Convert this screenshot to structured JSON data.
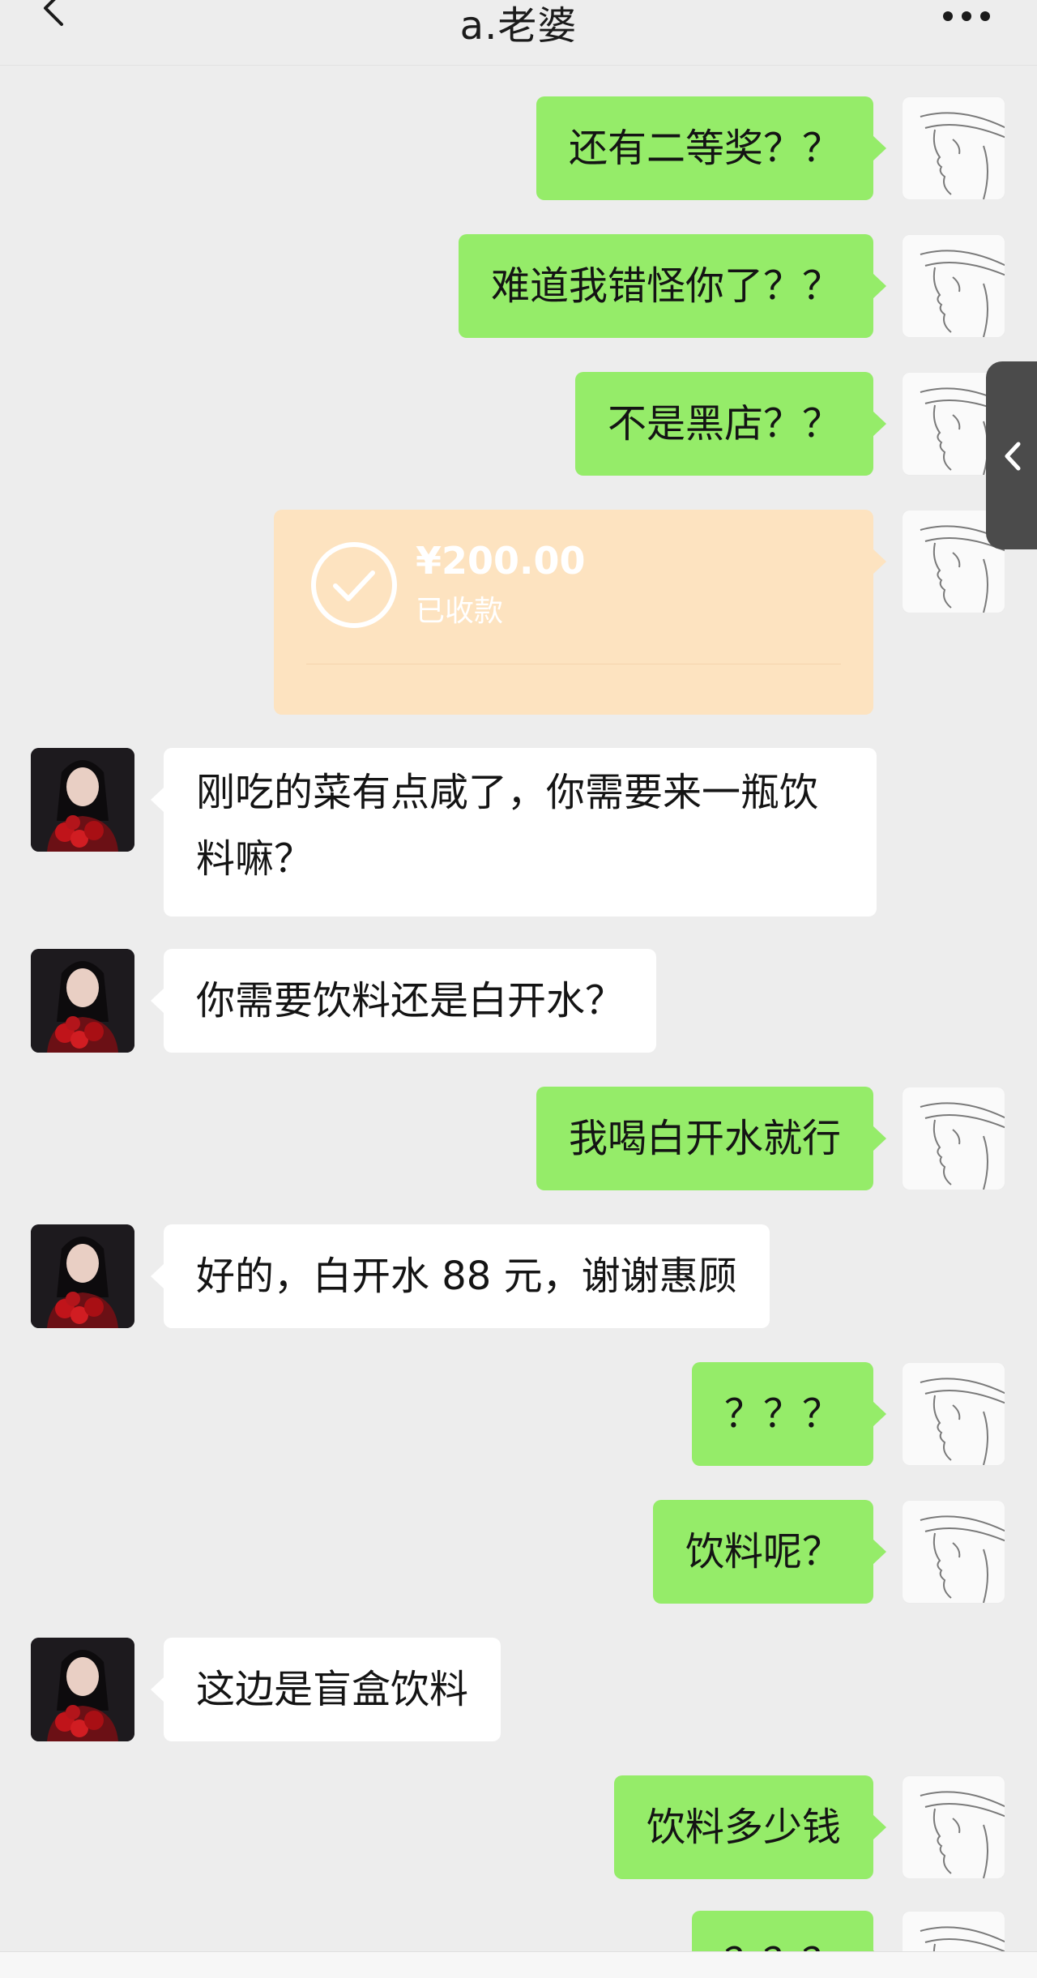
{
  "header": {
    "title": "a.老婆",
    "back_icon": "chevron-left-icon",
    "more_icon": "more-dots-icon"
  },
  "messages": [
    {
      "sender": "me",
      "text": "还有二等奖？？"
    },
    {
      "sender": "me",
      "text": "难道我错怪你了？？"
    },
    {
      "sender": "me",
      "text": "不是黑店？？"
    },
    {
      "sender": "me",
      "type": "transfer",
      "amount": "¥200.00",
      "status": "已收款"
    },
    {
      "sender": "her",
      "text": "刚吃的菜有点咸了，你需要来一瓶饮料嘛？"
    },
    {
      "sender": "her",
      "text": "你需要饮料还是白开水？"
    },
    {
      "sender": "me",
      "text": "我喝白开水就行"
    },
    {
      "sender": "her",
      "text": "好的，白开水 88 元，谢谢惠顾"
    },
    {
      "sender": "me",
      "text": "？？？"
    },
    {
      "sender": "me",
      "text": "饮料呢？"
    },
    {
      "sender": "her",
      "text": "这边是盲盒饮料"
    },
    {
      "sender": "me",
      "text": "饮料多少钱"
    },
    {
      "sender": "me",
      "text": "？？？"
    }
  ],
  "colors": {
    "background": "#ededed",
    "my_bubble": "#95ec69",
    "her_bubble": "#ffffff",
    "transfer_card": "#fde3c0"
  },
  "side_handle_icon": "chevron-left-icon"
}
